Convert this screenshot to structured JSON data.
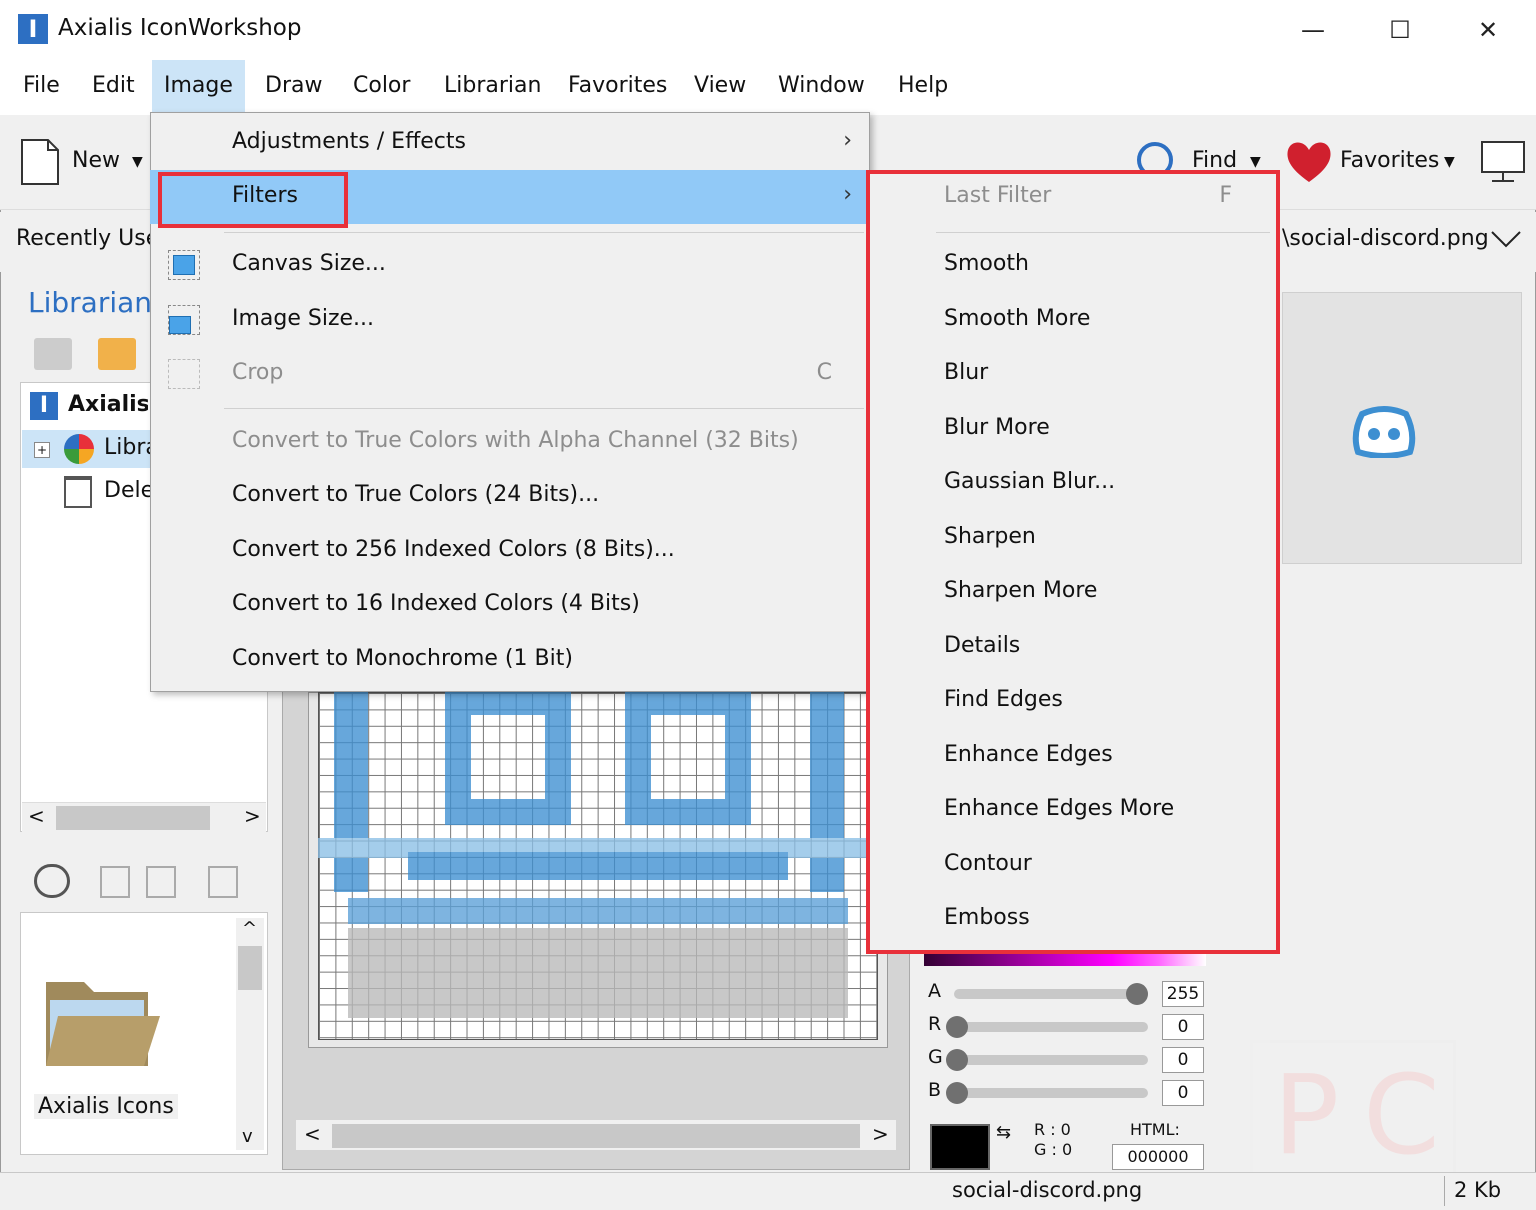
{
  "window": {
    "title": "Axialis IconWorkshop",
    "app_icon_letter": "I",
    "minimize": "—",
    "maximize": "☐",
    "close": "✕"
  },
  "menubar": [
    "File",
    "Edit",
    "Image",
    "Draw",
    "Color",
    "Librarian",
    "Favorites",
    "View",
    "Window",
    "Help"
  ],
  "toolbar": {
    "new_label": "New",
    "find_label": "Find",
    "favorites_label": "Favorites"
  },
  "recent": {
    "label": "Recently Used",
    "path": "\\social-discord.png"
  },
  "left_pane": {
    "title": "Librarian",
    "tree": [
      "Axialis Icons",
      "Library",
      "Deleted"
    ],
    "folder_label": "Axialis Icons"
  },
  "image_menu": {
    "items": [
      {
        "label": "Adjustments / Effects",
        "submenu": true,
        "enabled": true
      },
      {
        "label": "Filters",
        "submenu": true,
        "enabled": true,
        "highlighted": true
      },
      {
        "label": "Canvas Size...",
        "enabled": true
      },
      {
        "label": "Image Size...",
        "enabled": true
      },
      {
        "label": "Crop",
        "accel": "C",
        "enabled": false
      },
      {
        "label": "Convert to True Colors with Alpha Channel (32 Bits)",
        "enabled": false
      },
      {
        "label": "Convert to True Colors (24 Bits)...",
        "enabled": true
      },
      {
        "label": "Convert to 256 Indexed Colors (8 Bits)...",
        "enabled": true
      },
      {
        "label": "Convert to 16 Indexed Colors (4 Bits)",
        "enabled": true
      },
      {
        "label": "Convert to Monochrome (1 Bit)",
        "enabled": true
      }
    ]
  },
  "filters_menu": {
    "last_filter": {
      "label": "Last Filter",
      "accel": "F",
      "enabled": false
    },
    "items": [
      "Smooth",
      "Smooth More",
      "Blur",
      "Blur More",
      "Gaussian Blur...",
      "Sharpen",
      "Sharpen More",
      "Details",
      "Find Edges",
      "Enhance Edges",
      "Enhance Edges More",
      "Contour",
      "Emboss"
    ]
  },
  "color_panel": {
    "channels": [
      {
        "name": "A",
        "value": "255",
        "level": 1.0
      },
      {
        "name": "R",
        "value": "0",
        "level": 0
      },
      {
        "name": "G",
        "value": "0",
        "level": 0
      },
      {
        "name": "B",
        "value": "0",
        "level": 0
      }
    ],
    "rgb_readout": {
      "r": "R :  0",
      "g": "G :  0"
    },
    "html_label": "HTML:",
    "html_value": "000000"
  },
  "status": {
    "filename": "social-discord.png",
    "size": "2 Kb"
  },
  "colors": {
    "highlight": "#91c9f7",
    "menubar_active": "#cce4f7",
    "annotation_red": "#e8303a",
    "discord_blue": "#3d8fd1"
  }
}
